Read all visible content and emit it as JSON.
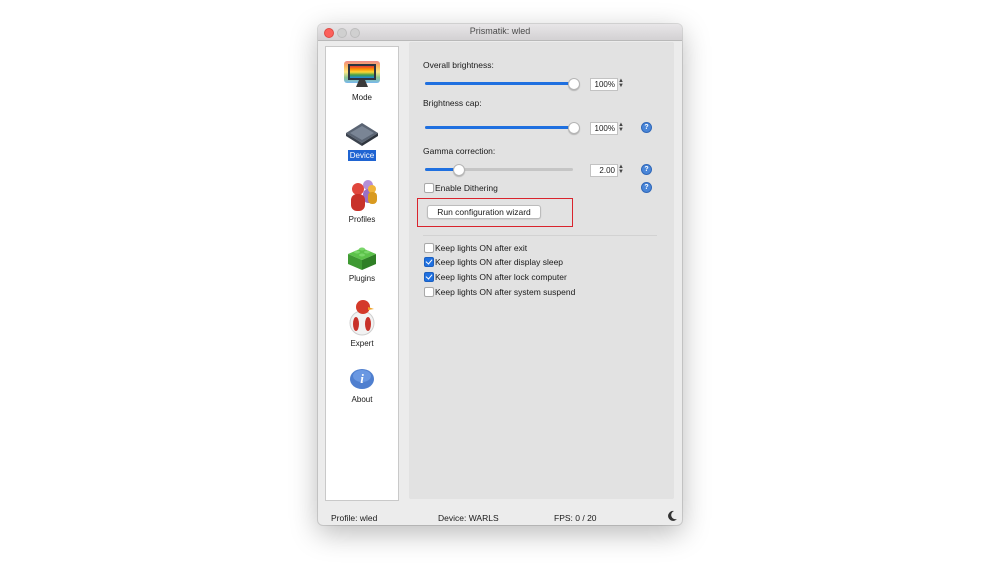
{
  "window": {
    "title": "Prismatik: wled"
  },
  "sidebar": {
    "items": [
      {
        "label": "Mode",
        "icon": "monitor-rainbow-icon",
        "selected": false
      },
      {
        "label": "Device",
        "icon": "chip-icon",
        "selected": true
      },
      {
        "label": "Profiles",
        "icon": "users-icon",
        "selected": false
      },
      {
        "label": "Plugins",
        "icon": "lego-brick-icon",
        "selected": false
      },
      {
        "label": "Expert",
        "icon": "penguin-icon",
        "selected": false
      },
      {
        "label": "About",
        "icon": "info-icon",
        "selected": false
      }
    ]
  },
  "device": {
    "overall_brightness": {
      "label": "Overall brightness:",
      "value": "100%",
      "level": 1.0
    },
    "brightness_cap": {
      "label": "Brightness cap:",
      "value": "100%",
      "level": 1.0
    },
    "gamma_correction": {
      "label": "Gamma correction:",
      "value": "2.00",
      "level": 0.22
    },
    "dithering": {
      "label": "Enable Dithering",
      "checked": false
    },
    "wizard_button": "Run configuration wizard",
    "keep_lights": [
      {
        "label": "Keep lights ON after exit",
        "checked": false
      },
      {
        "label": "Keep lights ON after display sleep",
        "checked": true
      },
      {
        "label": "Keep lights ON after lock computer",
        "checked": true
      },
      {
        "label": "Keep lights ON after system suspend",
        "checked": false
      }
    ],
    "help_glyph": "?"
  },
  "status": {
    "profile": "Profile: wled",
    "device": "Device: WARLS",
    "fps": "FPS: 0 / 20",
    "mode_icon": "moon-icon"
  },
  "colors": {
    "accent": "#1f70e0",
    "selection": "#1f64d2",
    "highlight": "#d9242d"
  }
}
